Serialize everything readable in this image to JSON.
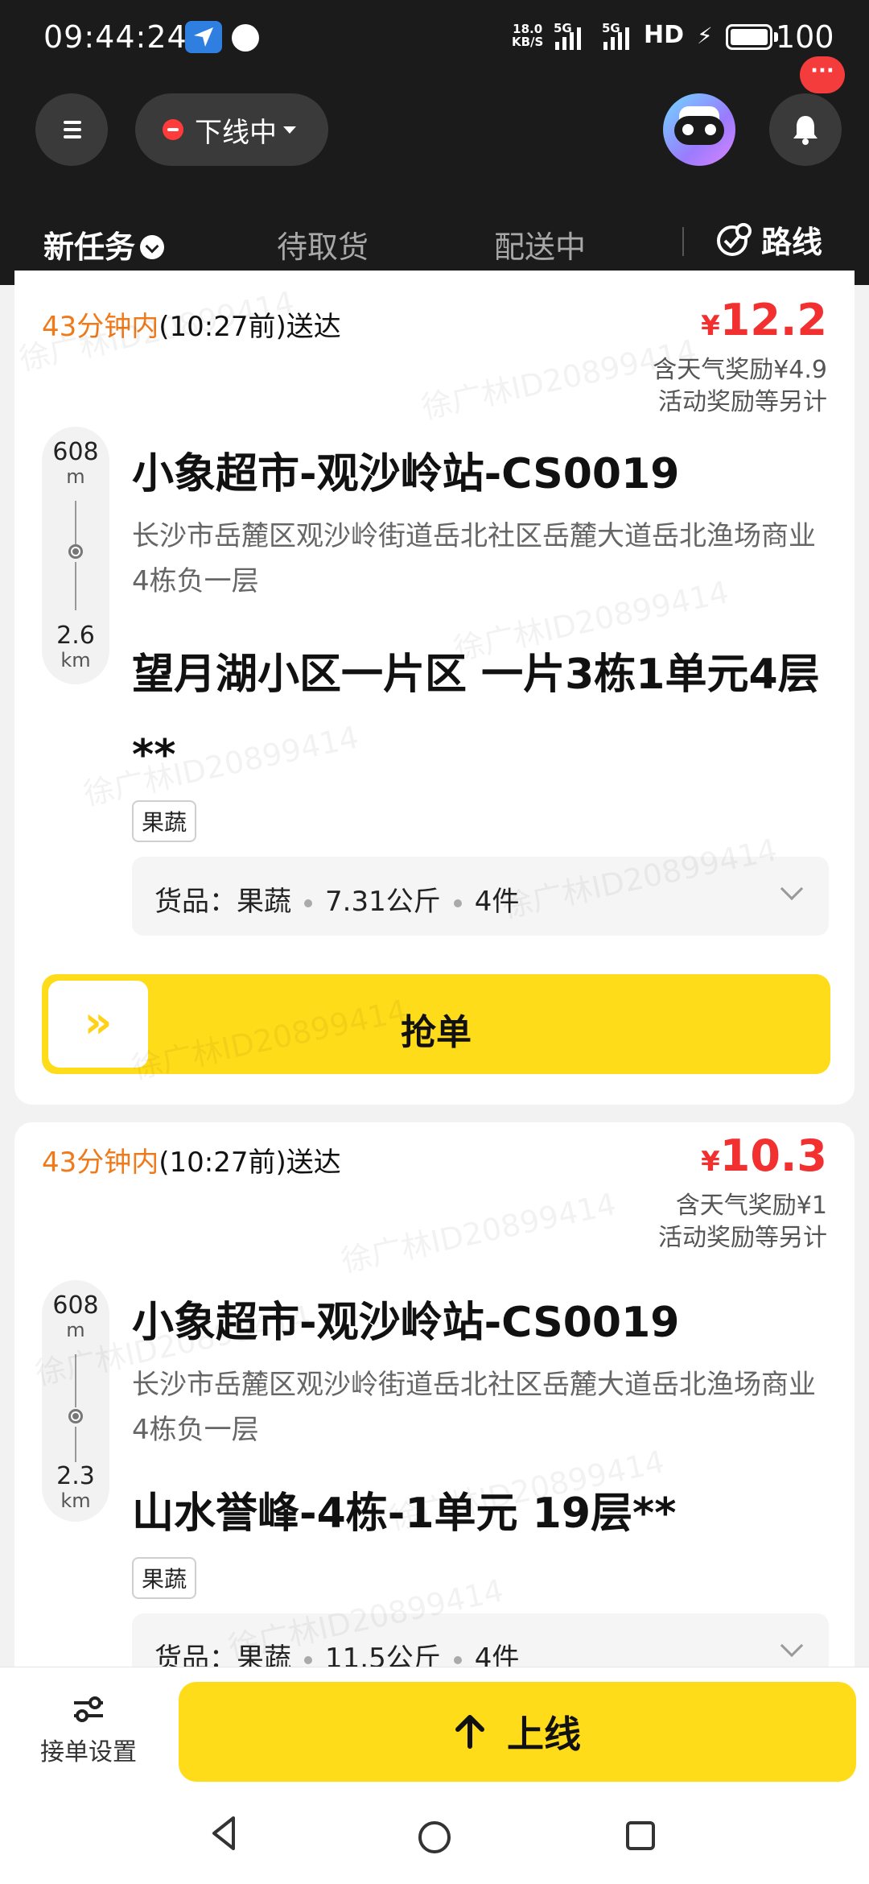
{
  "status_bar": {
    "time": "09:44:24",
    "speed_value": "18.0",
    "speed_unit": "KB/S",
    "sig1": "5G",
    "sig2": "5G",
    "hd": "HD",
    "battery": "100"
  },
  "header": {
    "status_label": "下线中",
    "notification_badge": "···"
  },
  "tabs": [
    {
      "label": "新任务",
      "active": true
    },
    {
      "label": "待取货",
      "active": false
    },
    {
      "label": "配送中",
      "active": false
    }
  ],
  "route_label": "路线",
  "orders": [
    {
      "eta_window": "43分钟内",
      "eta_time": "(10:27前)送达",
      "price_symbol": "¥",
      "price": "12.2",
      "bonus_weather": "含天气奖励¥4.9",
      "bonus_note": "活动奖励等另计",
      "pickup_distance": "608",
      "pickup_unit": "m",
      "drop_distance": "2.6",
      "drop_unit": "km",
      "store": "小象超市-观沙岭站-CS0019",
      "store_address": "长沙市岳麓区观沙岭街道岳北社区岳麓大道岳北渔场商业4栋负一层",
      "destination": "望月湖小区一片区 一片3栋1单元4层**",
      "tag": "果蔬",
      "goods_label": "货品：果蔬",
      "goods_weight": "7.31公斤",
      "goods_count": "4件",
      "grab_label": "抢单",
      "grab_handle": "»"
    },
    {
      "eta_window": "43分钟内",
      "eta_time": "(10:27前)送达",
      "price_symbol": "¥",
      "price": "10.3",
      "bonus_weather": "含天气奖励¥1",
      "bonus_note": "活动奖励等另计",
      "pickup_distance": "608",
      "pickup_unit": "m",
      "drop_distance": "2.3",
      "drop_unit": "km",
      "store": "小象超市-观沙岭站-CS0019",
      "store_address": "长沙市岳麓区观沙岭街道岳北社区岳麓大道岳北渔场商业4栋负一层",
      "destination": "山水誉峰-4栋-1单元 19层**",
      "tag": "果蔬",
      "goods_label": "货品：果蔬",
      "goods_weight": "11.5公斤",
      "goods_count": "4件"
    }
  ],
  "watermark": "徐广林ID20899414",
  "bottom_bar": {
    "settings_label": "接单设置",
    "online_label": "上线"
  },
  "colors": {
    "accent_yellow": "#ffdc19",
    "price_red": "#f23030",
    "eta_orange": "#f07a1a",
    "header_bg": "#1b1b1b"
  }
}
